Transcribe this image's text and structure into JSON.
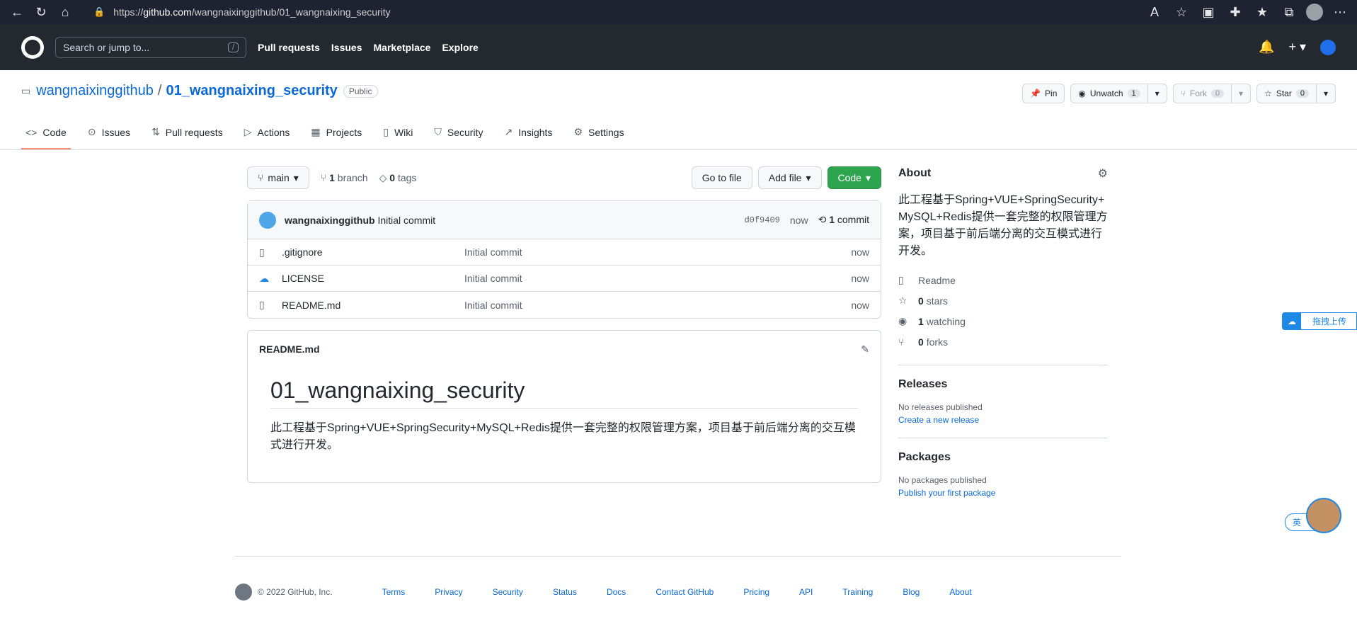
{
  "browser": {
    "url_prefix": "https://",
    "url_host": "github.com",
    "url_path": "/wangnaixinggithub/01_wangnaixing_security"
  },
  "header": {
    "search_placeholder": "Search or jump to...",
    "slash": "/",
    "nav": [
      "Pull requests",
      "Issues",
      "Marketplace",
      "Explore"
    ]
  },
  "repo": {
    "owner": "wangnaixinggithub",
    "name": "01_wangnaixing_security",
    "visibility": "Public"
  },
  "actions": {
    "pin": "Pin",
    "unwatch": "Unwatch",
    "watch_count": "1",
    "fork": "Fork",
    "fork_count": "0",
    "star": "Star",
    "star_count": "0"
  },
  "tabs": [
    "Code",
    "Issues",
    "Pull requests",
    "Actions",
    "Projects",
    "Wiki",
    "Security",
    "Insights",
    "Settings"
  ],
  "toolbar": {
    "branch": "main",
    "branches_count": "1",
    "branches_label": "branch",
    "tags_count": "0",
    "tags_label": "tags",
    "go_to_file": "Go to file",
    "add_file": "Add file",
    "code": "Code"
  },
  "commit": {
    "author": "wangnaixinggithub",
    "message": "Initial commit",
    "sha": "d0f9409",
    "time": "now",
    "count": "1",
    "count_label": "commit"
  },
  "files": [
    {
      "name": ".gitignore",
      "message": "Initial commit",
      "age": "now"
    },
    {
      "name": "LICENSE",
      "message": "Initial commit",
      "age": "now"
    },
    {
      "name": "README.md",
      "message": "Initial commit",
      "age": "now"
    }
  ],
  "readme": {
    "filename": "README.md",
    "heading": "01_wangnaixing_security",
    "body": "此工程基于Spring+VUE+SpringSecurity+MySQL+Redis提供一套完整的权限管理方案，项目基于前后端分离的交互模式进行开发。"
  },
  "about": {
    "title": "About",
    "description": "此工程基于Spring+VUE+SpringSecurity+MySQL+Redis提供一套完整的权限管理方案，项目基于前后端分离的交互模式进行开发。",
    "readme": "Readme",
    "stars_count": "0",
    "stars_label": "stars",
    "watching_count": "1",
    "watching_label": "watching",
    "forks_count": "0",
    "forks_label": "forks"
  },
  "releases": {
    "title": "Releases",
    "none": "No releases published",
    "link": "Create a new release"
  },
  "packages": {
    "title": "Packages",
    "none": "No packages published",
    "link": "Publish your first package"
  },
  "footer": {
    "copyright": "© 2022 GitHub, Inc.",
    "links": [
      "Terms",
      "Privacy",
      "Security",
      "Status",
      "Docs",
      "Contact GitHub",
      "Pricing",
      "API",
      "Training",
      "Blog",
      "About"
    ]
  },
  "overlays": {
    "upload": "拖拽上传",
    "lang": "英"
  }
}
